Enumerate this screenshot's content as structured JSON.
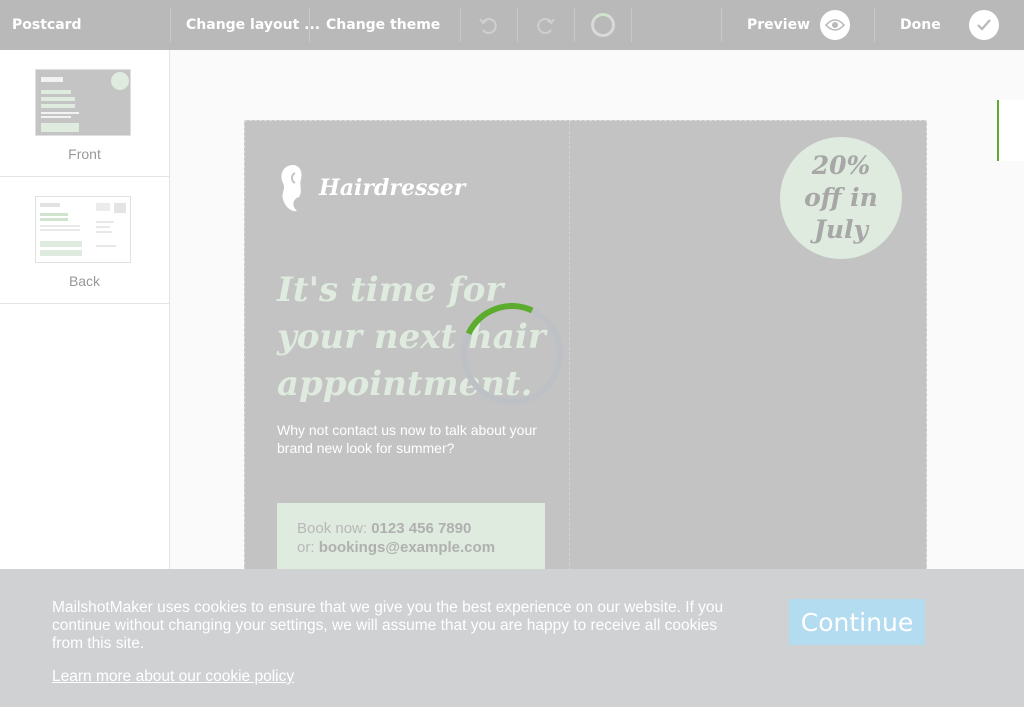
{
  "toolbar": {
    "title": "Postcard",
    "change_layout": "Change layout ...",
    "change_theme": "Change theme",
    "preview": "Preview",
    "done": "Done",
    "icons": [
      "undo-icon",
      "redo-icon",
      "loading-icon",
      "eye-icon",
      "check-icon"
    ]
  },
  "sidebar": {
    "pages": [
      {
        "label": "Front"
      },
      {
        "label": "Back"
      }
    ]
  },
  "postcard": {
    "logo_text": "Hairdresser",
    "headline": "It's time for your next hair appointment.",
    "subtext": "Why not contact us now to talk about your brand new look for summer?",
    "booking_label_1": "Book now:",
    "booking_phone": "0123 456 7890",
    "booking_label_2": "or:",
    "booking_email": "bookings@example.com",
    "offer": "20% off in July"
  },
  "cookie_banner": {
    "text": "MailshotMaker uses cookies to ensure that we give you the best experience on our website. If you continue without changing your settings, we will assume that you are happy to receive all cookies from this site.",
    "link": "Learn more about our cookie policy",
    "button": "Continue"
  },
  "colors": {
    "accent_green": "#5cac2e",
    "toolbar_bg": "#b9b9b9",
    "mint": "#deebde",
    "button_blue": "#b4dcf0"
  }
}
